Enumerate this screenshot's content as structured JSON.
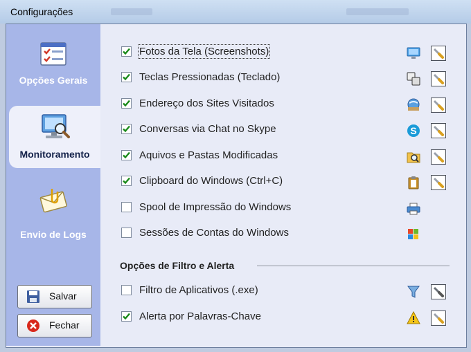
{
  "window": {
    "title": "Configurações"
  },
  "sidebar": {
    "tabs": [
      {
        "label": "Opções Gerais",
        "icon": "checklist-icon",
        "active": false
      },
      {
        "label": "Monitoramento",
        "icon": "monitor-magnifier-icon",
        "active": true
      },
      {
        "label": "Envio de Logs",
        "icon": "envelope-icon",
        "active": false
      }
    ],
    "buttons": {
      "save_label": "Salvar",
      "close_label": "Fechar"
    }
  },
  "monitoring": {
    "items": [
      {
        "label": "Fotos da Tela (Screenshots)",
        "checked": true,
        "icon": "screen-icon",
        "has_settings": true
      },
      {
        "label": "Teclas Pressionadas (Teclado)",
        "checked": true,
        "icon": "keyboard-keys-icon",
        "has_settings": true
      },
      {
        "label": "Endereço dos Sites Visitados",
        "checked": true,
        "icon": "web-globe-icon",
        "has_settings": true
      },
      {
        "label": "Conversas via Chat no Skype",
        "checked": true,
        "icon": "skype-icon",
        "has_settings": true
      },
      {
        "label": "Aquivos e Pastas Modificadas",
        "checked": true,
        "icon": "folder-search-icon",
        "has_settings": true
      },
      {
        "label": "Clipboard do Windows (Ctrl+C)",
        "checked": true,
        "icon": "clipboard-icon",
        "has_settings": true
      },
      {
        "label": "Spool de Impressão do Windows",
        "checked": false,
        "icon": "printer-icon",
        "has_settings": false
      },
      {
        "label": "Sessões de Contas do Windows",
        "checked": false,
        "icon": "windows-logo-icon",
        "has_settings": false
      }
    ]
  },
  "filters": {
    "section_title": "Opções de Filtro e Alerta",
    "items": [
      {
        "label": "Filtro de Aplicativos (.exe)",
        "checked": false,
        "icon": "filter-funnel-icon",
        "has_settings": true
      },
      {
        "label": "Alerta por Palavras-Chave",
        "checked": true,
        "icon": "warning-icon",
        "has_settings": true
      }
    ]
  },
  "colors": {
    "sidebar": "#a7b6e8",
    "content": "#e8ebf7",
    "check": "#1a8a1a"
  }
}
